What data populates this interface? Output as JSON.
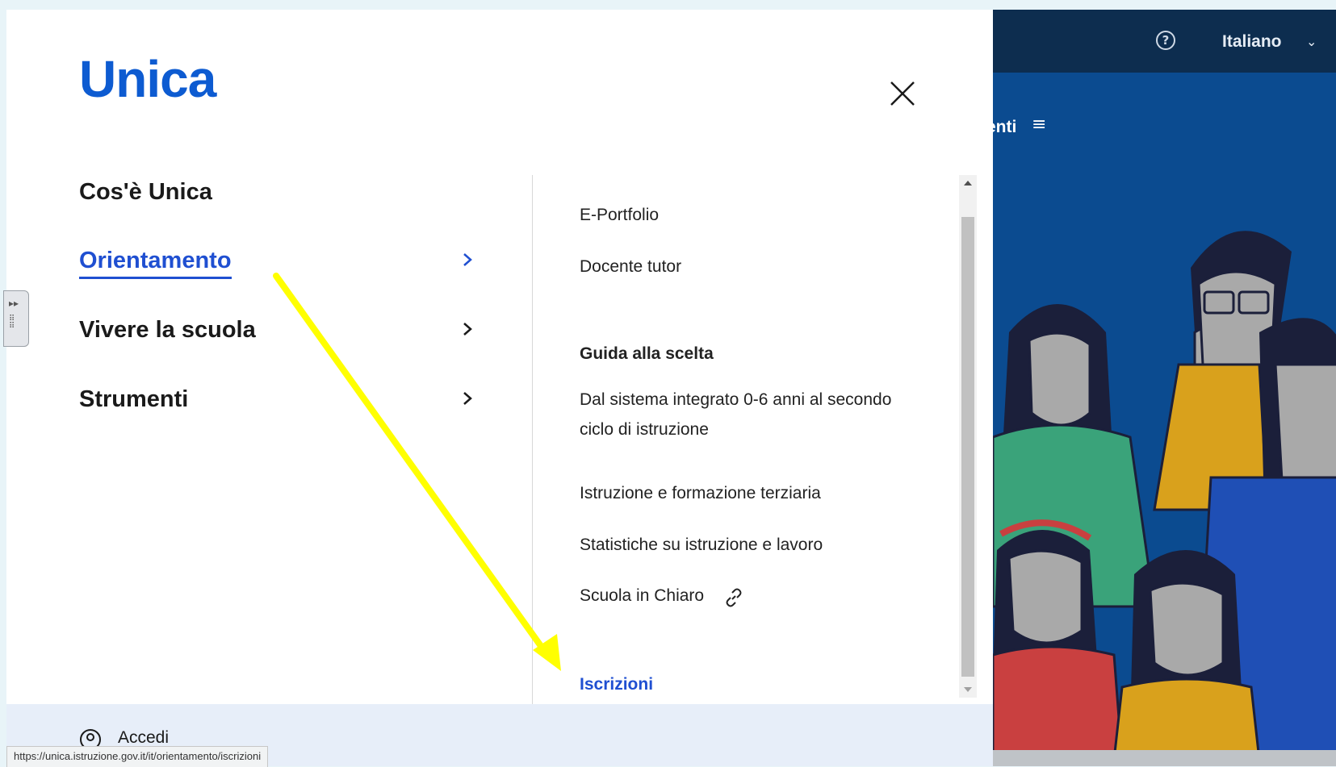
{
  "header": {
    "logo_text": "Unica",
    "close_icon": "close-icon"
  },
  "nav": {
    "items": [
      {
        "label": "Cos'è Unica",
        "active": false
      },
      {
        "label": "Orientamento",
        "active": true
      },
      {
        "label": "Vivere la scuola",
        "active": false
      },
      {
        "label": "Strumenti",
        "active": false
      }
    ]
  },
  "submenu": {
    "eportfolio": "E-Portfolio",
    "docente": "Docente tutor",
    "guida_heading": "Guida alla scelta",
    "dal_sistema": "Dal sistema integrato 0-6 anni al secondo ciclo di istruzione",
    "istruzione": "Istruzione e formazione terziaria",
    "statistiche": "Statistiche su istruzione e lavoro",
    "scuola_chiaro": "Scuola in Chiaro",
    "scuola_chiaro_icon": "external-link-icon",
    "iscrizioni": "Iscrizioni"
  },
  "footer": {
    "accedi": "Accedi"
  },
  "background_site": {
    "language": "Italiano",
    "nav_fragment": "enti"
  },
  "status_bar": {
    "url": "https://unica.istruzione.gov.it/it/orientamento/iscrizioni"
  },
  "colors": {
    "accent": "#1f4fd1",
    "logo": "#0d5bd1",
    "annotation": "#ffff00",
    "dark_navy": "#0d2d4f",
    "site_blue": "#0b4b90"
  }
}
